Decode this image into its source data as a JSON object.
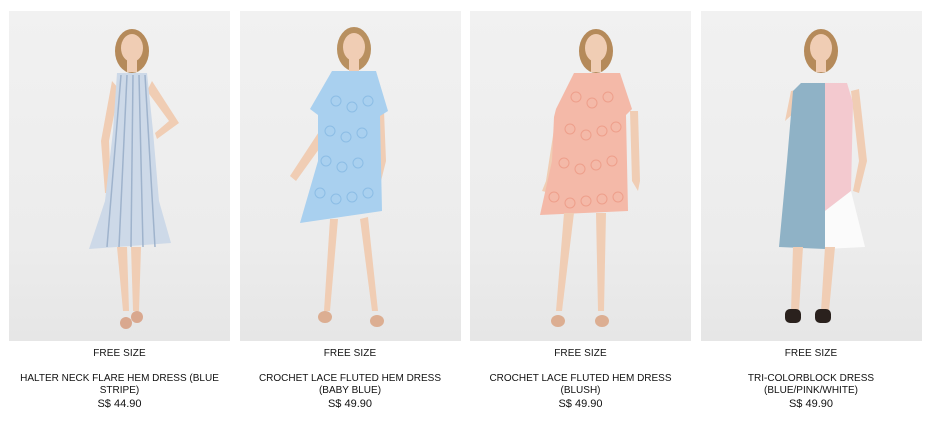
{
  "products": [
    {
      "size": "FREE SIZE",
      "name": "HALTER NECK FLARE HEM DRESS (BLUE STRIPE)",
      "price": "S$ 44.90",
      "dress_color": "#cdd9e8",
      "accent_color": "#9fb3cc"
    },
    {
      "size": "FREE SIZE",
      "name": "CROCHET LACE FLUTED HEM DRESS (BABY BLUE)",
      "price": "S$ 49.90",
      "dress_color": "#a9d0ef",
      "accent_color": "#8cbde5"
    },
    {
      "size": "FREE SIZE",
      "name": "CROCHET LACE FLUTED HEM DRESS (BLUSH)",
      "price": "S$ 49.90",
      "dress_color": "#f4b9a8",
      "accent_color": "#ee9f8b"
    },
    {
      "size": "FREE SIZE",
      "name": "TRI-COLORBLOCK DRESS (BLUE/PINK/WHITE)",
      "price": "S$ 49.90",
      "dress_color": "#8fb2c6",
      "accent_color": "#f3c9cf"
    }
  ]
}
